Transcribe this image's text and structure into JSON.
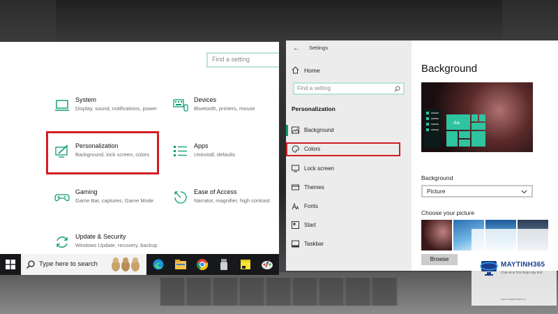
{
  "left_panel": {
    "search_placeholder": "Find a setting",
    "categories": [
      {
        "title": "System",
        "subtitle": "Display, sound, notifications, power",
        "icon": "laptop-icon"
      },
      {
        "title": "Devices",
        "subtitle": "Bluetooth, printers, mouse",
        "icon": "keyboard-icon"
      },
      {
        "title": "Personalization",
        "subtitle": "Background, lock screen, colors",
        "icon": "paint-brush-icon"
      },
      {
        "title": "Apps",
        "subtitle": "Uninstall, defaults",
        "icon": "apps-list-icon"
      },
      {
        "title": "Gaming",
        "subtitle": "Game Bar, captures, Game Mode",
        "icon": "gamepad-icon"
      },
      {
        "title": "Ease of Access",
        "subtitle": "Narrator, magnifier, high contrast",
        "icon": "ease-of-access-icon"
      },
      {
        "title": "Update & Security",
        "subtitle": "Windows Update, recovery, backup",
        "icon": "sync-icon"
      }
    ]
  },
  "taskbar": {
    "search_text": "Type here to search",
    "apps": [
      "edge-icon",
      "file-explorer-icon",
      "chrome-icon",
      "usb-icon",
      "sticky-notes-icon",
      "paint-icon"
    ]
  },
  "settings_window": {
    "title": "Settings",
    "home_label": "Home",
    "search_placeholder": "Find a setting",
    "section_title": "Personalization",
    "nav_items": [
      {
        "label": "Background",
        "icon": "image-icon"
      },
      {
        "label": "Colors",
        "icon": "palette-icon"
      },
      {
        "label": "Lock screen",
        "icon": "lock-screen-icon"
      },
      {
        "label": "Themes",
        "icon": "themes-icon"
      },
      {
        "label": "Fonts",
        "icon": "fonts-icon"
      },
      {
        "label": "Start",
        "icon": "start-icon"
      },
      {
        "label": "Taskbar",
        "icon": "taskbar-icon"
      }
    ],
    "page_title": "Background",
    "preview_tile_text": "Aa",
    "background_label": "Background",
    "background_value": "Picture",
    "choose_label": "Choose your picture",
    "browse_label": "Browse"
  },
  "logo": {
    "name": "MAYTINH365",
    "tagline": "Chia sẻ & Thủ thuật máy tính",
    "website": "www.maytinh365.vn"
  },
  "colors": {
    "accent": "#0a9a73",
    "highlight_red": "#d21d23",
    "search_border": "#b7e4d9"
  }
}
